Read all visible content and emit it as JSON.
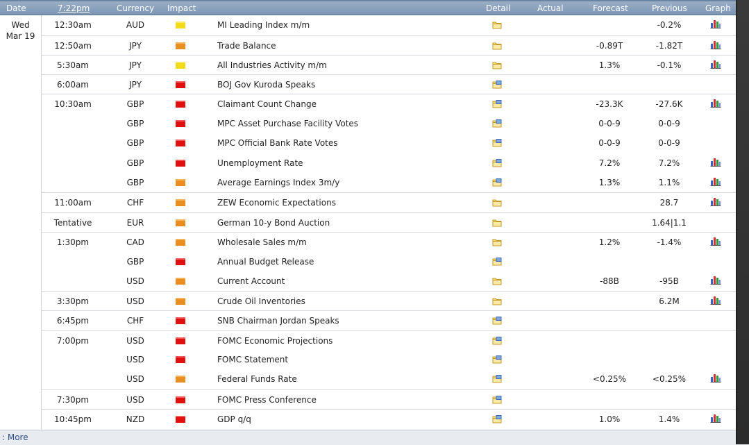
{
  "header": {
    "date": "Date",
    "time": "7:22pm",
    "currency": "Currency",
    "impact": "Impact",
    "detail": "Detail",
    "actual": "Actual",
    "forecast": "Forecast",
    "previous": "Previous",
    "graph": "Graph"
  },
  "day": {
    "weekday": "Wed",
    "date": "Mar 19"
  },
  "colors": {
    "high": "#e01010",
    "medium": "#ea8e22",
    "low": "#f2dc1a"
  },
  "events": [
    {
      "time": "12:30am",
      "currency": "AUD",
      "impact": "low",
      "event": "MI Leading Index m/m",
      "forecast": "",
      "previous": "-0.2%",
      "graph": true
    },
    {
      "time": "12:50am",
      "currency": "JPY",
      "impact": "medium",
      "event": "Trade Balance",
      "forecast": "-0.89T",
      "previous": "-1.82T",
      "graph": true
    },
    {
      "time": "5:30am",
      "currency": "JPY",
      "impact": "low",
      "event": "All Industries Activity m/m",
      "forecast": "1.3%",
      "previous": "-0.1%",
      "graph": true
    },
    {
      "time": "6:00am",
      "currency": "JPY",
      "impact": "high",
      "event": "BOJ Gov Kuroda Speaks",
      "forecast": "",
      "previous": "",
      "graph": false
    },
    {
      "time": "10:30am",
      "currency": "GBP",
      "impact": "high",
      "event": "Claimant Count Change",
      "forecast": "-23.3K",
      "previous": "-27.6K",
      "graph": true
    },
    {
      "time": "",
      "currency": "GBP",
      "impact": "high",
      "event": "MPC Asset Purchase Facility Votes",
      "forecast": "0-0-9",
      "previous": "0-0-9",
      "graph": false
    },
    {
      "time": "",
      "currency": "GBP",
      "impact": "high",
      "event": "MPC Official Bank Rate Votes",
      "forecast": "0-0-9",
      "previous": "0-0-9",
      "graph": false
    },
    {
      "time": "",
      "currency": "GBP",
      "impact": "high",
      "event": "Unemployment Rate",
      "forecast": "7.2%",
      "previous": "7.2%",
      "graph": true
    },
    {
      "time": "",
      "currency": "GBP",
      "impact": "medium",
      "event": "Average Earnings Index 3m/y",
      "forecast": "1.3%",
      "previous": "1.1%",
      "graph": true
    },
    {
      "time": "11:00am",
      "currency": "CHF",
      "impact": "medium",
      "event": "ZEW Economic Expectations",
      "forecast": "",
      "previous": "28.7",
      "graph": true
    },
    {
      "time": "Tentative",
      "currency": "EUR",
      "impact": "medium",
      "event": "German 10-y Bond Auction",
      "forecast": "",
      "previous": "1.64|1.1",
      "graph": false
    },
    {
      "time": "1:30pm",
      "currency": "CAD",
      "impact": "medium",
      "event": "Wholesale Sales m/m",
      "forecast": "1.2%",
      "previous": "-1.4%",
      "graph": true
    },
    {
      "time": "",
      "currency": "GBP",
      "impact": "high",
      "event": "Annual Budget Release",
      "forecast": "",
      "previous": "",
      "graph": false
    },
    {
      "time": "",
      "currency": "USD",
      "impact": "medium",
      "event": "Current Account",
      "forecast": "-88B",
      "previous": "-95B",
      "graph": true
    },
    {
      "time": "3:30pm",
      "currency": "USD",
      "impact": "medium",
      "event": "Crude Oil Inventories",
      "forecast": "",
      "previous": "6.2M",
      "graph": true
    },
    {
      "time": "6:45pm",
      "currency": "CHF",
      "impact": "high",
      "event": "SNB Chairman Jordan Speaks",
      "forecast": "",
      "previous": "",
      "graph": false
    },
    {
      "time": "7:00pm",
      "currency": "USD",
      "impact": "high",
      "event": "FOMC Economic Projections",
      "forecast": "",
      "previous": "",
      "graph": false
    },
    {
      "time": "",
      "currency": "USD",
      "impact": "high",
      "event": "FOMC Statement",
      "forecast": "",
      "previous": "",
      "graph": false
    },
    {
      "time": "",
      "currency": "USD",
      "impact": "medium",
      "event": "Federal Funds Rate",
      "forecast": "<0.25%",
      "previous": "<0.25%",
      "graph": true
    },
    {
      "time": "7:30pm",
      "currency": "USD",
      "impact": "high",
      "event": "FOMC Press Conference",
      "forecast": "",
      "previous": "",
      "graph": false
    },
    {
      "time": "10:45pm",
      "currency": "NZD",
      "impact": "high",
      "event": "GDP q/q",
      "forecast": "1.0%",
      "previous": "1.4%",
      "graph": true
    }
  ],
  "footer": {
    "more": ": More"
  }
}
